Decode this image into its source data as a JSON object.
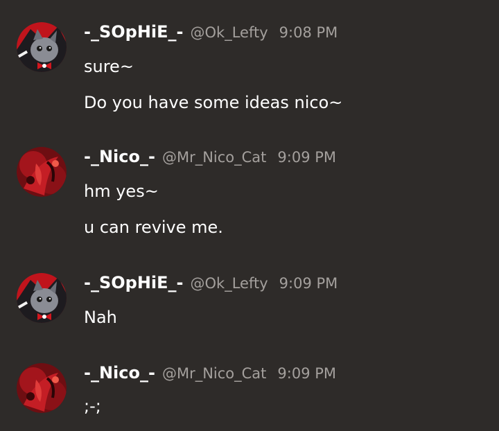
{
  "messages": [
    {
      "author": "-_SOpHiE_-",
      "handle": "@Ok_Lefty",
      "time": "9:08 PM",
      "avatar": "sophie-avatar",
      "lines": [
        "sure~",
        "Do you have some ideas nico~"
      ]
    },
    {
      "author": "-_Nico_-",
      "handle": "@Mr_Nico_Cat",
      "time": "9:09 PM",
      "avatar": "nico-avatar",
      "lines": [
        "hm yes~",
        "u can revive me."
      ]
    },
    {
      "author": "-_SOpHiE_-",
      "handle": "@Ok_Lefty",
      "time": "9:09 PM",
      "avatar": "sophie-avatar",
      "lines": [
        "Nah"
      ]
    },
    {
      "author": "-_Nico_-",
      "handle": "@Mr_Nico_Cat",
      "time": "9:09 PM",
      "avatar": "nico-avatar",
      "lines": [
        ";-;"
      ]
    }
  ],
  "colors": {
    "background": "#2e2b29",
    "username": "#ffffff",
    "meta": "#a4a09d",
    "text": "#ffffff"
  }
}
